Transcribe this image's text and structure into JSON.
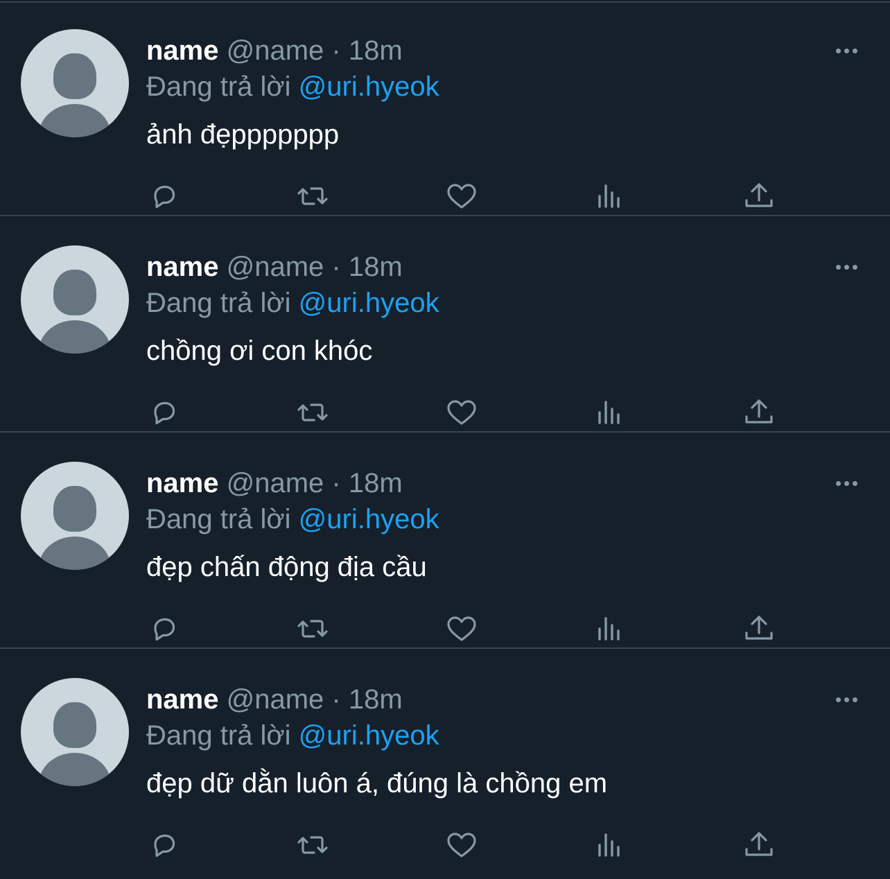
{
  "tweets": [
    {
      "display_name": "name",
      "handle": "@name",
      "separator": "·",
      "time": "18m",
      "reply_prefix": "Đang trả lời",
      "reply_to": "@uri.hyeok",
      "text": "ảnh đẹppppppp"
    },
    {
      "display_name": "name",
      "handle": "@name",
      "separator": "·",
      "time": "18m",
      "reply_prefix": "Đang trả lời",
      "reply_to": "@uri.hyeok",
      "text": "chồng ơi con khóc"
    },
    {
      "display_name": "name",
      "handle": "@name",
      "separator": "·",
      "time": "18m",
      "reply_prefix": "Đang trả lời",
      "reply_to": "@uri.hyeok",
      "text": "đẹp chấn động địa cầu"
    },
    {
      "display_name": "name",
      "handle": "@name",
      "separator": "·",
      "time": "18m",
      "reply_prefix": "Đang trả lời",
      "reply_to": "@uri.hyeok",
      "text": "đẹp dữ dằn luôn á, đúng là chồng em"
    }
  ],
  "action_icons": [
    "reply-icon",
    "retweet-icon",
    "like-icon",
    "analytics-icon",
    "share-icon"
  ],
  "colors": {
    "background": "#15202b",
    "divider": "#38444d",
    "secondary_text": "#8899a6",
    "mention": "#1da1f2",
    "avatar_bg": "#ccd6dd",
    "avatar_fg": "#66757f"
  }
}
